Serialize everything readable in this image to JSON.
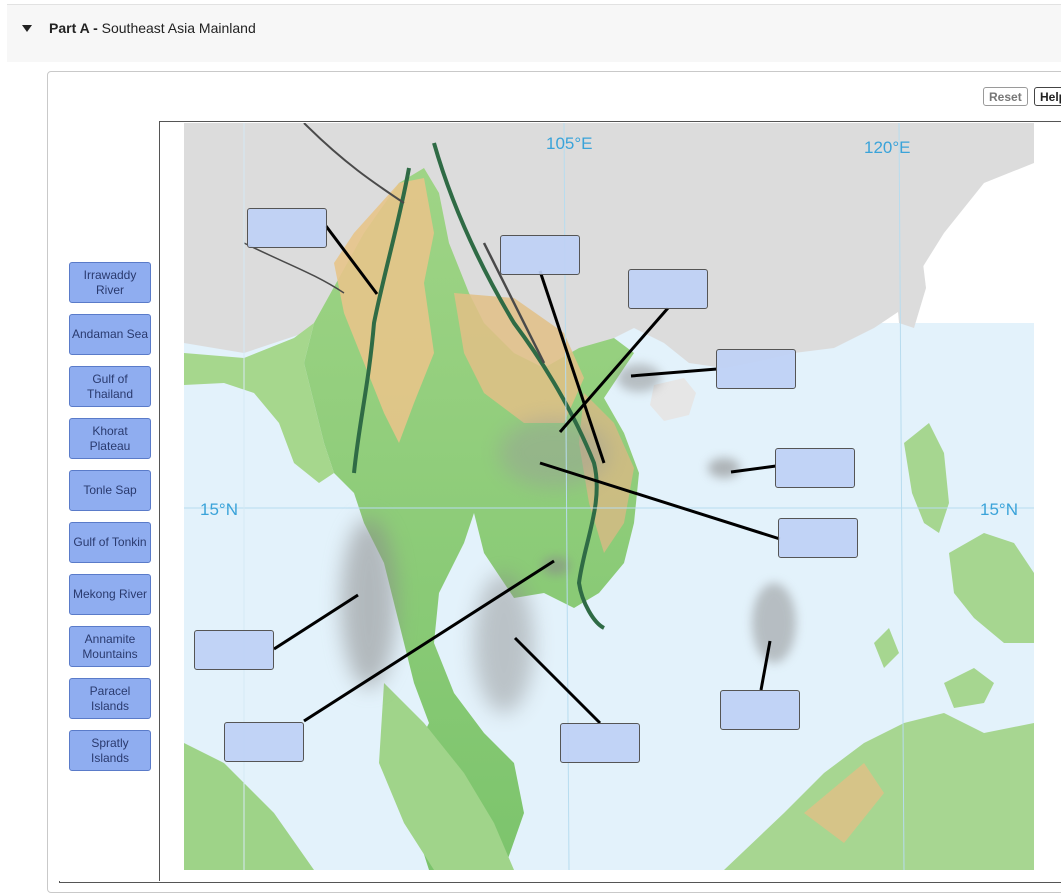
{
  "part": {
    "label": "Part A -",
    "title": "Southeast Asia Mainland"
  },
  "toolbar": {
    "reset": "Reset",
    "help": "Help"
  },
  "labels": [
    "Irrawaddy\nRiver",
    "Andaman Sea",
    "Gulf of\nThailand",
    "Khorat\nPlateau",
    "Tonle Sap",
    "Gulf of Tonkin",
    "Mekong River",
    "Annamite\nMountains",
    "Paracel\nIslands",
    "Spratly\nIslands"
  ],
  "map": {
    "lon_105": "105°E",
    "lon_120": "120°E",
    "lat_left": "15°N",
    "lat_right": "15°N"
  },
  "colors": {
    "chip": "#8fadf0",
    "drop_target": "#c8d7f5",
    "sea": "#cfe8f7",
    "land_north": "#dcdcdc",
    "lowland": "#8fcf7a",
    "highland": "#e7c48a",
    "grid_label": "#3aa3d9"
  }
}
